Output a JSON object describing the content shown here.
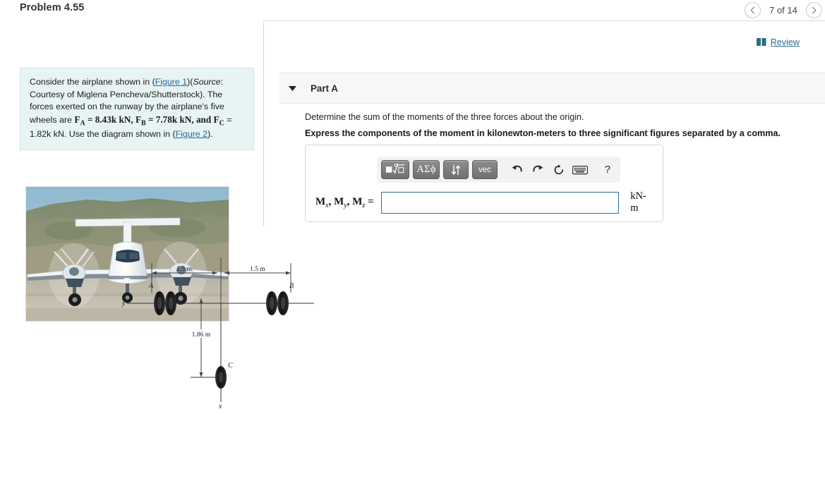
{
  "header": {
    "problem_title": "Problem 4.55",
    "pager": {
      "prev_icon": "chevron-left-icon",
      "next_icon": "chevron-right-icon",
      "label": "7 of 14"
    }
  },
  "left": {
    "statement": {
      "line_prefix": "Consider the airplane shown in (",
      "figure1_link": "Figure 1",
      "source_open": ")(",
      "source_word": "Source",
      "source_rest": ": Courtesy of Miglena Pencheva/Shutterstock). The forces exerted on the runway by the airplane's five wheels are ",
      "fa_symbol": "F",
      "fa_sub": "A",
      "fa_value": " = 8.43k kN, ",
      "fb_symbol": "F",
      "fb_sub": "B",
      "fb_value": " = 7.78k kN, and ",
      "fc_symbol": "F",
      "fc_sub": "C",
      "fc_value": " = 1.82k kN. Use the diagram shown in (",
      "figure2_link": "Figure 2",
      "tail": ")."
    },
    "figure_alt": "airplane-front-view-photo"
  },
  "right": {
    "review": {
      "icon": "book-icon",
      "label": "Review",
      "color": "#2b6e87"
    },
    "part": {
      "caret_icon": "caret-down-icon",
      "label": "Part A"
    },
    "question": "Determine the sum of the moments of the three forces about the origin.",
    "instruction": "Express the components of the moment in kilonewton-meters to three significant figures separated by a comma.",
    "toolbar": {
      "template_btn": "■√□",
      "greek_btn": "ΑΣϕ",
      "updown_btn": "↓↑",
      "vec_btn": "vec",
      "undo_icon": "undo-icon",
      "redo_icon": "redo-icon",
      "reset_icon": "reset-icon",
      "keyboard_icon": "keyboard-icon",
      "help_icon": "help-icon",
      "help_label": "?"
    },
    "answer": {
      "label_mx": "M",
      "sub_x": "x",
      "label_my": "M",
      "sub_y": "y",
      "label_mz": "M",
      "sub_z": "z",
      "equals": "=",
      "value": "",
      "placeholder": "",
      "units": "kN-m"
    }
  },
  "diagram": {
    "dim_left": "1.5 m",
    "dim_right": "1.5 m",
    "dim_down": "1.86 m",
    "label_a": "A",
    "label_b": "B",
    "label_c": "C",
    "axis_y": "y",
    "axis_x": "x"
  }
}
